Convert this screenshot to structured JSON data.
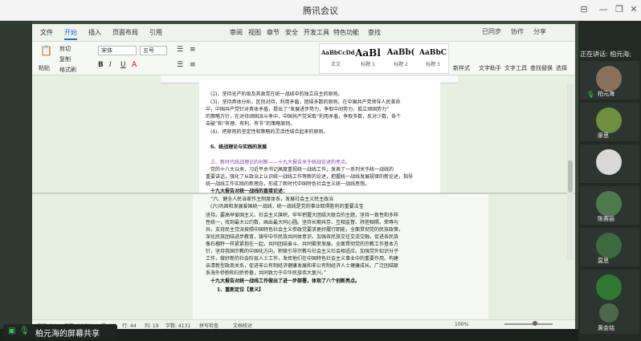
{
  "window": {
    "title": "腾讯会议",
    "controls": [
      "⊟",
      "—",
      "❐",
      "✕"
    ]
  },
  "doc": {
    "menu": [
      "文件",
      "开始",
      "插入",
      "页面布局",
      "引用",
      "审阅",
      "视图",
      "章节",
      "安全",
      "开发工具",
      "特色功能",
      "查找"
    ],
    "menu_right": [
      "已同步",
      "协作",
      "分享"
    ],
    "ribbon": {
      "paste": "粘贴",
      "cut": "剪切",
      "copy": "复制",
      "format_painter": "格式刷",
      "font": "宋体",
      "size": "五号",
      "styles": [
        {
          "sample": "AaBbCcDd",
          "label": "正文"
        },
        {
          "sample": "AaBl",
          "label": "标题 1"
        },
        {
          "sample": "AaBb(",
          "label": "标题 2"
        },
        {
          "sample": "AaBbC",
          "label": "标题 3"
        }
      ],
      "new_style": "新样式",
      "tools": [
        "文字助手",
        "文字工具",
        "查找替换",
        "选择"
      ]
    },
    "lines_top": [
      "(2)、坚持无产阶级及其政党在统一战线中的独立自主的原则。",
      "(3)、坚持具体分析，区别对待，利用矛盾，团结多数的原则。在中国共产党领导人民革命",
      "中，中国共产党针对具体矛盾，提出了“发展进步势力，争取中间势力，孤立顽固势力”",
      "的策略方针，在对待顽固派斗争中，中国共产党采取“利用矛盾，争取多数，反对少数，各个",
      "击破”和“有理、有利、有节”的策略原则。",
      "(4)、把原则的坚定性和策略的灵活性结合起来的原则。",
      "6、统战理论与实践的发展",
      "三、新时代统战理论的创新——十九大报告关于统战论述的亮点。",
      "党的十八大以来，习近平总书记高度重视统一战线工作，发表了一系列关于统一战线的",
      "重要讲话，强化了从政治上认识统一战线工作等新的论述，把握统一战线发展规律的新论述，指导",
      "统一战线工作实践的新理念，形成了新时代中国特色社会主义统一战线思想。",
      "十九大报告对统一战线的直接论述：",
      "“六、健全人民当家作主制度体系，发展社会主义民主政治",
      "(六)巩固和发展爱国统一战线，统一战线是党的事业取得胜利的重要法宝"
    ],
    "lines_bottom": [
      "坚持。要高举爱国主义、社会主义旗帜，牢牢把握大团结大联合的主题，坚持一致性和多样",
      "性统一，找到最大公约数，画出最大同心圆。坚持长期共存、互相监督、肝胆相照、荣辱与",
      "共，支持民主党派按照中国特色社会主义参政党要求更好履行职能，全面贯彻党的民族政策，",
      "深化民族团结进步教育，铸牢中华民族共同体意识，加强各民族交往交流交融，促进各民族",
      "像石榴籽一样紧紧抱在一起，共同团结奋斗、共同繁荣发展。全面贯彻党的宗教工作基本方",
      "针，坚持我国宗教的中国化方向，积极引导宗教与社会主义社会相适应。加强党外知识分子",
      "工作，做好新的社会阶层人士工作，发挥他们在中国特色社会主义事业中的重要作用。构建",
      "亲清新型政商关系，促进非公有制经济健康发展和非公有制经济人士健康成长。广泛团结联",
      "系海外侨胞和归侨侨眷，共同致力于中华民族伟大复兴。”",
      "十九大报告对统一战线工作做出了进一步部署，体现了八个创新亮点。",
      "1、重新定位【意义】"
    ],
    "status": [
      "页码: 14",
      "页面: 16/34",
      "节: 1/1",
      "行: 44",
      "列: 19",
      "字数: 4131",
      "拼写检查",
      "文档校对"
    ],
    "zoom": "100%"
  },
  "sidebar": {
    "speaking_label": "正在讲话: 柏元海;",
    "participants": [
      "柏元海",
      "廖思",
      "",
      "陈赛丽",
      "莫思",
      "",
      "黄金铭"
    ]
  },
  "share_banner": "柏元海的屏幕共享"
}
